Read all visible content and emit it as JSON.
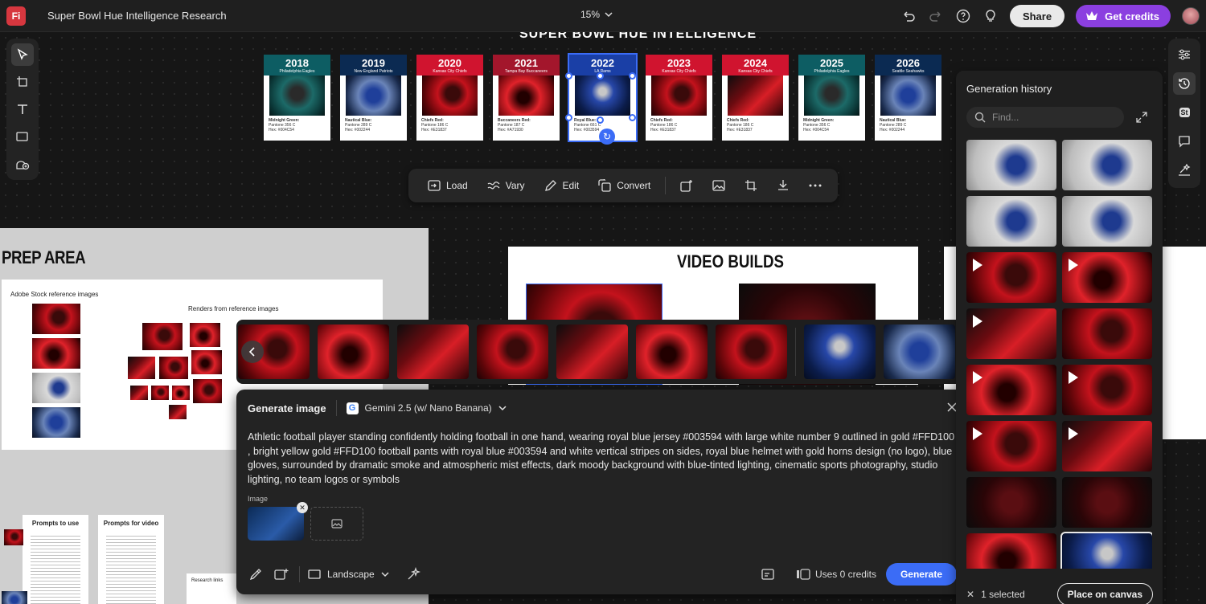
{
  "app": {
    "logo_text": "Fi",
    "title": "Super Bowl Hue Intelligence Research",
    "zoom": "15%"
  },
  "topbar": {
    "share_label": "Share",
    "credits_label": "Get credits"
  },
  "board": {
    "title": "SUPER BOWL HUE INTELLIGENCE"
  },
  "cards": [
    {
      "year": "2018",
      "team": "Philadelphia Eagles",
      "color_name": "Midnight Green:",
      "pantone": "Pantone 356 C",
      "hex": "Hex: #004C54",
      "head": "#0d5d63",
      "pic": "g-teal"
    },
    {
      "year": "2019",
      "team": "New England Patriots",
      "color_name": "Nautical Blue:",
      "pantone": "Pantone 289 C",
      "hex": "Hex: #002244",
      "head": "#0b2a52",
      "pic": "g-blue2"
    },
    {
      "year": "2020",
      "team": "Kansas City Chiefs",
      "color_name": "Chiefs Red:",
      "pantone": "Pantone 186 C",
      "hex": "Hex: #E31837",
      "head": "#d0142f",
      "pic": "g-red"
    },
    {
      "year": "2021",
      "team": "Tampa Bay Buccaneers",
      "color_name": "Buccaneers Red:",
      "pantone": "Pantone 187 C",
      "hex": "Hex: #A71930",
      "head": "#a3162c",
      "pic": "g-red2"
    },
    {
      "year": "2022",
      "team": "LA Rams",
      "color_name": "Royal Blue:",
      "pantone": "Pantone 661 C",
      "hex": "Hex: #003594",
      "head": "#1a3fa6",
      "pic": "g-blue"
    },
    {
      "year": "2023",
      "team": "Kansas City Chiefs",
      "color_name": "Chiefs Red:",
      "pantone": "Pantone 186 C",
      "hex": "Hex: #E31837",
      "head": "#d0142f",
      "pic": "g-red"
    },
    {
      "year": "2024",
      "team": "Kansas City Chiefs",
      "color_name": "Chiefs Red:",
      "pantone": "Pantone 186 C",
      "hex": "Hex: #E31837",
      "head": "#d0142f",
      "pic": "g-red3"
    },
    {
      "year": "2025",
      "team": "Philadelphia Eagles",
      "color_name": "Midnight Green:",
      "pantone": "Pantone 356 C",
      "hex": "Hex: #004C54",
      "head": "#0d5d63",
      "pic": "g-teal"
    },
    {
      "year": "2026",
      "team": "Seattle Seahawks",
      "color_name": "Nautical Blue:",
      "pantone": "Pantone 289 C",
      "hex": "Hex: #002244",
      "head": "#0b2a52",
      "pic": "g-blue2"
    }
  ],
  "actionbar": {
    "load": "Load",
    "vary": "Vary",
    "edit": "Edit",
    "convert": "Convert"
  },
  "prep": {
    "title": "PREP AREA",
    "stock_label": "Adobe Stock reference images",
    "renders_label": "Renders from reference images",
    "prompts_label": "Prompts to use",
    "prompts_video_label": "Prompts for video",
    "research_label": "Research links"
  },
  "video_builds": {
    "title": "VIDEO BUILDS"
  },
  "filmstrip": [
    "g-red",
    "g-red2",
    "g-red3",
    "g-red",
    "g-red3",
    "g-red2",
    "g-red",
    "g-blue",
    "g-blue2"
  ],
  "generate": {
    "title": "Generate image",
    "model": "Gemini 2.5 (w/ Nano Banana)",
    "prompt": "Athletic football player standing confidently holding football in one hand, wearing royal blue jersey #003594 with large white number 9 outlined in gold #FFD100 , bright yellow gold  #FFD100  football pants with royal blue #003594 and white vertical stripes on sides, royal blue helmet with gold horns design (no logo), blue gloves, surrounded by dramatic smoke and atmospheric mist effects, dark moody background with blue-tinted lighting, cinematic sports photography, studio lighting, no team logos or symbols",
    "image_label": "Image",
    "aspect": "Landscape",
    "credits": "Uses 0 credits",
    "generate_label": "Generate"
  },
  "history": {
    "title": "Generation history",
    "search_placeholder": "Find...",
    "items": [
      {
        "style": "g-white",
        "video": false
      },
      {
        "style": "g-white",
        "video": false
      },
      {
        "style": "g-white",
        "video": false
      },
      {
        "style": "g-white",
        "video": false
      },
      {
        "style": "g-red",
        "video": true
      },
      {
        "style": "g-red2",
        "video": true
      },
      {
        "style": "g-red3",
        "video": true
      },
      {
        "style": "g-red",
        "video": false
      },
      {
        "style": "g-red2",
        "video": true
      },
      {
        "style": "g-red",
        "video": true
      },
      {
        "style": "g-red",
        "video": true
      },
      {
        "style": "g-red3",
        "video": true
      },
      {
        "style": "g-dark",
        "video": false
      },
      {
        "style": "g-dark",
        "video": false
      },
      {
        "style": "g-red2",
        "video": false
      },
      {
        "style": "g-blue",
        "video": false,
        "selected": true
      }
    ],
    "selected_text": "1 selected",
    "place_label": "Place on canvas"
  },
  "colors": {
    "accent": "#3b6cf6",
    "credits": "#8b3fe0",
    "selection": "#3b6cf6"
  }
}
